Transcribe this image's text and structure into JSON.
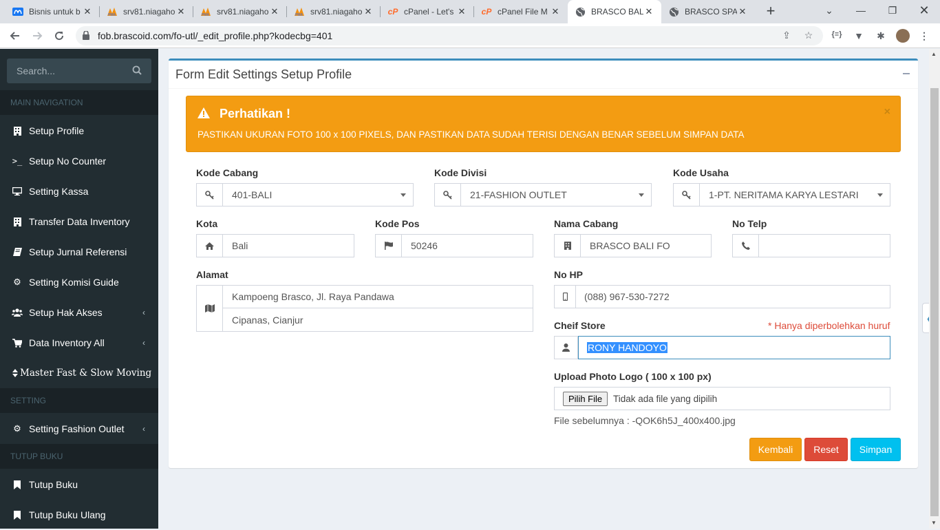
{
  "browser": {
    "tabs": [
      {
        "title": "Bisnis untuk b",
        "favicon": "meta-icon",
        "color": "#1877f2"
      },
      {
        "title": "srv81.niagaho",
        "favicon": "phpmyadmin-icon",
        "color": "#f29111"
      },
      {
        "title": "srv81.niagaho",
        "favicon": "phpmyadmin-icon",
        "color": "#f29111"
      },
      {
        "title": "srv81.niagaho",
        "favicon": "phpmyadmin-icon",
        "color": "#f29111"
      },
      {
        "title": "cPanel - Let's",
        "favicon": "cpanel-icon",
        "color": "#ff6c2c"
      },
      {
        "title": "cPanel File M",
        "favicon": "cpanel-icon",
        "color": "#ff6c2c"
      },
      {
        "title": "BRASCO BALI",
        "favicon": "globe-icon",
        "color": "#5f6368"
      },
      {
        "title": "BRASCO SPA",
        "favicon": "globe-icon",
        "color": "#5f6368"
      }
    ],
    "url": "fob.brascoid.com/fo-utl/_edit_profile.php?kodecbg=401"
  },
  "sidebar": {
    "search_placeholder": "Search...",
    "header_main": "MAIN NAVIGATION",
    "header_setting": "SETTING",
    "header_tutup": "TUTUP BUKU",
    "items": [
      {
        "label": "Setup Profile",
        "icon": "building-icon"
      },
      {
        "label": "Setup No Counter",
        "icon": "terminal-icon"
      },
      {
        "label": "Setting Kassa",
        "icon": "desktop-icon"
      },
      {
        "label": "Transfer Data Inventory",
        "icon": "building-icon"
      },
      {
        "label": "Setup Jurnal Referensi",
        "icon": "book-icon"
      },
      {
        "label": "Setting Komisi Guide",
        "icon": "cogs-icon"
      },
      {
        "label": "Setup Hak Akses",
        "icon": "users-icon"
      },
      {
        "label": "Data Inventory All",
        "icon": "cart-icon"
      },
      {
        "label": "Master Fast & Slow Moving",
        "icon": "sort-icon"
      },
      {
        "label": "Setting Fashion Outlet",
        "icon": "cogs-icon"
      },
      {
        "label": "Tutup Buku",
        "icon": "bookmark-icon"
      },
      {
        "label": "Tutup Buku Ulang",
        "icon": "bookmark-icon"
      }
    ]
  },
  "form": {
    "title": "Form Edit Settings Setup Profile",
    "alert": {
      "title": "Perhatikan !",
      "message": "PASTIKAN UKURAN FOTO 100 x 100 PIXELS, DAN PASTIKAN DATA SUDAH TERISI DENGAN BENAR SEBELUM SIMPAN DATA",
      "color": "#f39c12"
    },
    "kode_cabang": {
      "label": "Kode Cabang",
      "value": "401-BALI"
    },
    "kode_divisi": {
      "label": "Kode Divisi",
      "value": "21-FASHION OUTLET"
    },
    "kode_usaha": {
      "label": "Kode Usaha",
      "value": "1-PT. NERITAMA KARYA LESTARI"
    },
    "kota": {
      "label": "Kota",
      "value": "Bali"
    },
    "kode_pos": {
      "label": "Kode Pos",
      "value": "50246"
    },
    "nama_cabang": {
      "label": "Nama Cabang",
      "value": "BRASCO BALI FO"
    },
    "no_telp": {
      "label": "No Telp",
      "value": ""
    },
    "alamat": {
      "label": "Alamat",
      "line1": "Kampoeng Brasco, Jl. Raya Pandawa",
      "line2": "Cipanas, Cianjur"
    },
    "no_hp": {
      "label": "No HP",
      "value": "(088) 967-530-7272"
    },
    "cheif_store": {
      "label": "Cheif Store",
      "value": "RONY HANDOYO",
      "hint": "* Hanya diperbolehkan huruf"
    },
    "upload": {
      "label": "Upload Photo Logo ( 100 x 100 px)",
      "button": "Pilih File",
      "status": "Tidak ada file yang dipilih",
      "previous": "File sebelumnya : -QOK6h5J_400x400.jpg"
    },
    "buttons": {
      "back": "Kembali",
      "reset": "Reset",
      "save": "Simpan"
    },
    "colors": {
      "back": "#f39c12",
      "reset": "#dd4b39",
      "save": "#00c0ef",
      "primary": "#3c8dbc"
    }
  }
}
